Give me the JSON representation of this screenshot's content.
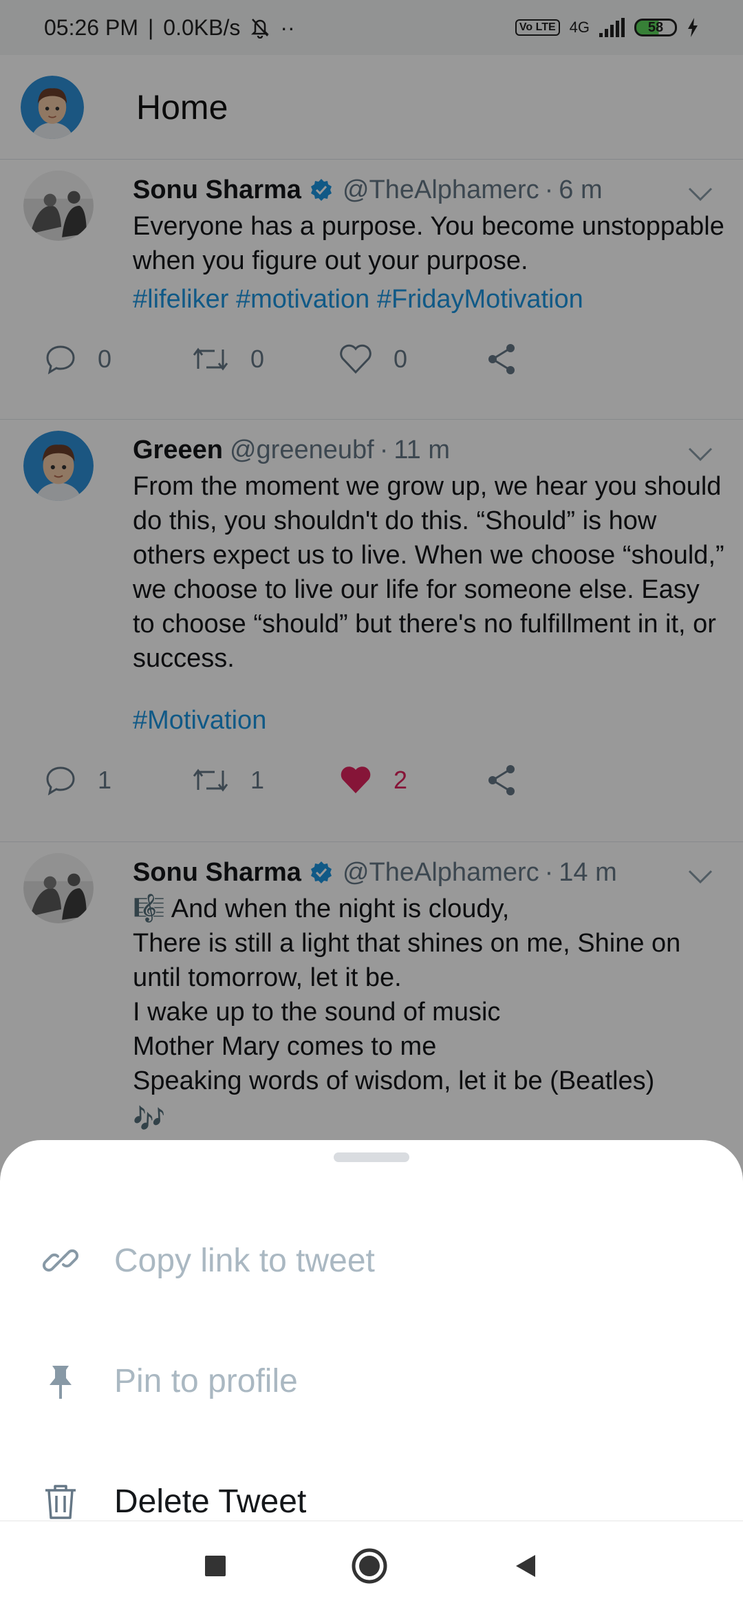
{
  "status_bar": {
    "time": "05:26 PM",
    "network_speed": "0.0KB/s",
    "more": "··",
    "volte": "Vo LTE",
    "network_type": "4G",
    "battery": "58"
  },
  "app_bar": {
    "title": "Home"
  },
  "tweets": [
    {
      "name": "Sonu Sharma",
      "verified": true,
      "handle": "@TheAlphamerc",
      "time": "6 m",
      "text": "Everyone has a purpose. You become unstoppable when you figure out your purpose.",
      "hashtags": "#lifeliker #motivation #FridayMotivation",
      "replies": "0",
      "retweets": "0",
      "likes": "0",
      "liked": false
    },
    {
      "name": "Greeen",
      "verified": false,
      "handle": "@greeneubf",
      "time": "11 m",
      "text": "From the moment we grow up, we hear you should do this, you shouldn't do this. “Should” is how others expect us to live. When we choose “should,” we choose to live our life for someone else. Easy to choose “should” but there's no fulfillment in it, or success.",
      "hashtags": "#Motivation",
      "replies": "1",
      "retweets": "1",
      "likes": "2",
      "liked": true
    },
    {
      "name": "Sonu Sharma",
      "verified": true,
      "handle": "@TheAlphamerc",
      "time": "14 m",
      "text": "🎼 And when the night is cloudy,\nThere is still a light that shines on me, Shine on until tomorrow, let it be.\nI wake up to the sound of music\nMother Mary comes to me\nSpeaking words of wisdom, let it be (Beatles)",
      "emoji_line": "🎶"
    }
  ],
  "sheet": {
    "copy_link": "Copy link to tweet",
    "pin": "Pin to profile",
    "delete": "Delete Tweet"
  },
  "colors": {
    "accent": "#1b95e0",
    "like": "#e0245e",
    "muted": "#657786",
    "disabled": "#aab8c2"
  },
  "icons": {
    "copy_link": "link-icon",
    "pin": "pin-icon",
    "delete": "trash-icon",
    "nav_recents": "square-icon",
    "nav_home": "circle-icon",
    "nav_back": "triangle-back-icon"
  }
}
